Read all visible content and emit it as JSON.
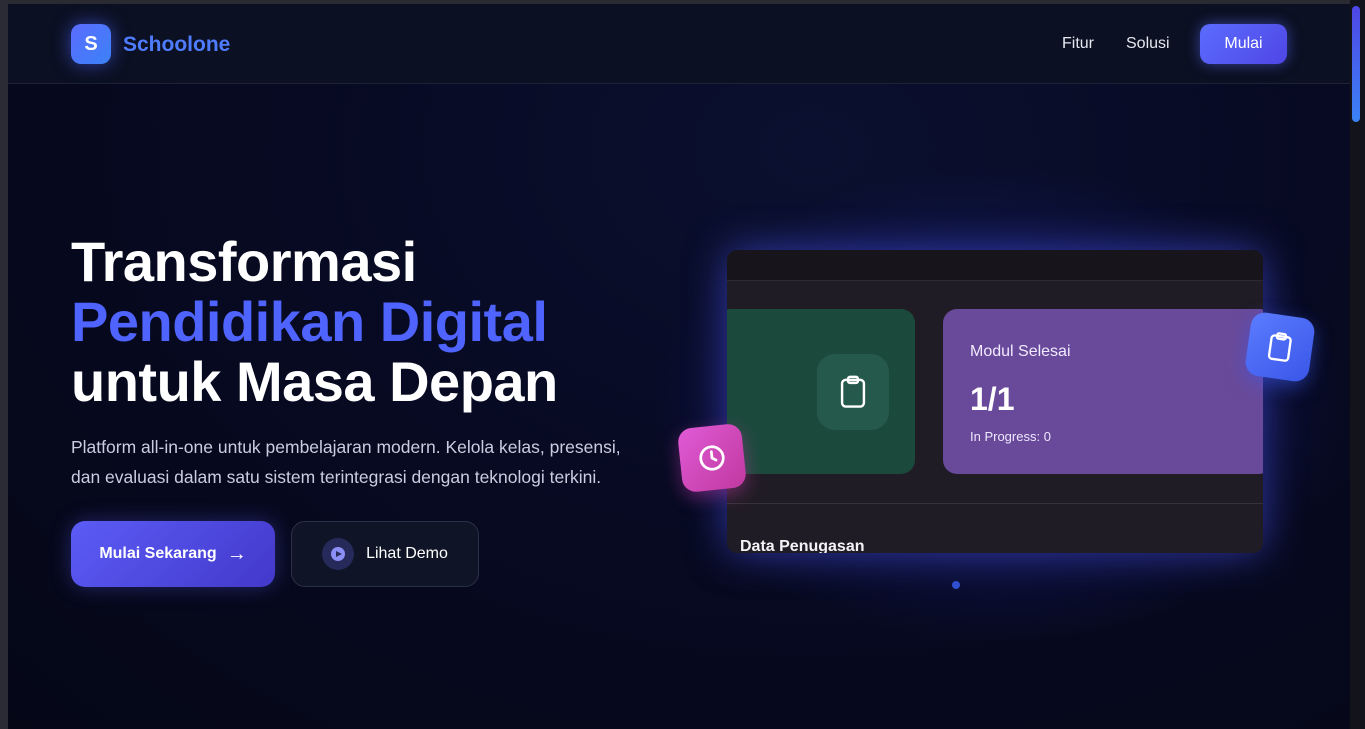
{
  "brand": {
    "logo_letter": "S",
    "name": "Schoolone"
  },
  "nav": {
    "links": [
      "Fitur",
      "Solusi"
    ],
    "cta": "Mulai"
  },
  "hero": {
    "title_line1": "Transformasi",
    "title_line2": "Pendidikan Digital",
    "title_line3": "untuk Masa Depan",
    "description": "Platform all-in-one untuk pembelajaran modern. Kelola kelas, presensi, dan evaluasi dalam satu sistem terintegrasi dengan teknologi terkini.",
    "primary_button": "Mulai Sekarang",
    "primary_arrow": "→",
    "secondary_button": "Lihat Demo"
  },
  "preview": {
    "card_label": "Modul Selesai",
    "card_value": "1/1",
    "card_sub": "In Progress: 0",
    "section_heading": "Data Penugasan"
  },
  "icons": {
    "green_card": "clipboard-icon",
    "float_left": "clock-icon",
    "float_right": "clipboard-icon",
    "secondary_button": "play-icon"
  },
  "colors": {
    "accent": "#4f63ff",
    "background": "#070a22",
    "primary_button": "#5b5cf6",
    "purple_card": "#694a9a",
    "green_card": "#1b4a3c",
    "float_clock": "#e05ad6",
    "float_clipboard": "#5b7cff"
  }
}
